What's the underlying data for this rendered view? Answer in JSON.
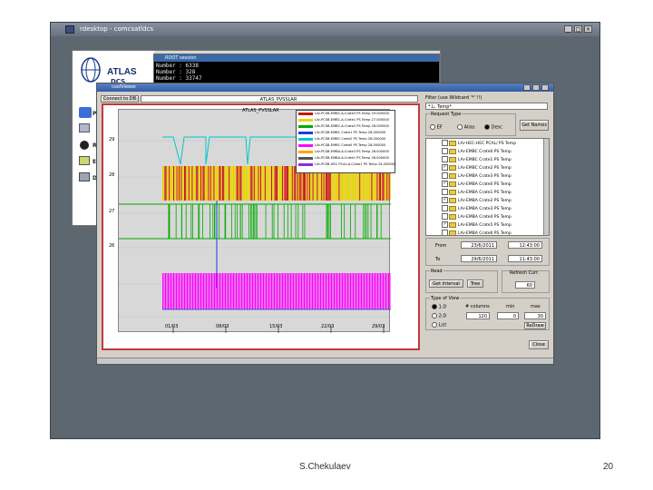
{
  "remote_desktop": {
    "title": "rdesktop - comcsatldcs",
    "controls": [
      "_",
      "□",
      "×"
    ]
  },
  "background_app": {
    "logo_text": "ATLAS",
    "logo_sub": "DCS",
    "side_letters": [
      "P",
      "R",
      "E",
      "D"
    ]
  },
  "root_session": {
    "title": "ROOT session",
    "lines": [
      "Number : 6338",
      "Number : 328",
      "Number : 33747"
    ]
  },
  "viewer": {
    "title": "coolViewer",
    "connect_label": "Connect to DB",
    "db_field": "ATLAS_PVSSLAR",
    "filter_label": "Filter (use Wildcard '*' !!)",
    "filter_value": "*.L: Temp*",
    "request_type_label": "Request Type",
    "request_types": [
      {
        "label": "EF",
        "selected": false
      },
      {
        "label": "Alias",
        "selected": false
      },
      {
        "label": "Desc",
        "selected": true
      }
    ],
    "get_names_button": "Get Names",
    "tree_items": [
      {
        "label": "LAr-HEC-HEC PCAL/ PS Temp",
        "checked": false
      },
      {
        "label": "LAr-EMBC Crate0 PS Temp",
        "checked": false
      },
      {
        "label": "LAr-EMBC Crate1 PS Temp",
        "checked": false
      },
      {
        "label": "LAr-EMBC Crate2 PS Temp",
        "checked": true
      },
      {
        "label": "LAr-EMBA Crate3 PS Temp",
        "checked": false
      },
      {
        "label": "LAr-EMBA Crate0 PS Temp",
        "checked": true
      },
      {
        "label": "LAr-EMBA Crate1 PS Temp",
        "checked": false
      },
      {
        "label": "LAr-EMBA Crate2 PS Temp",
        "checked": true
      },
      {
        "label": "LAr-EMBA Crate3 PS Temp",
        "checked": false
      },
      {
        "label": "LAr-EMBA Crate4 PS Temp",
        "checked": false
      },
      {
        "label": "LAr-EMBA Crate5 PS Temp",
        "checked": true
      },
      {
        "label": "LAr-EMBA Crate6 PS Temp",
        "checked": false
      }
    ],
    "from_label": "From",
    "from_date": "23/6/2011",
    "from_time": "12:43:00",
    "to_label": "To",
    "to_date": "29/6/2011",
    "to_time": "11:43:00",
    "read_label": "Read",
    "get_interval_button": "Get Interval",
    "tree_button": "Tree",
    "refresh_label": "Refresh Curr.",
    "refresh_value": "60",
    "view_type_label": "Type of View",
    "view_types": [
      {
        "label": "1:D",
        "selected": true
      },
      {
        "label": "2:D",
        "selected": false
      },
      {
        "label": "List",
        "selected": false
      }
    ],
    "columns_label": "# columns",
    "columns_value": "120",
    "min_label": "min",
    "min_value": "0",
    "max_label": "max",
    "max_value": "30",
    "redraw_button": "ReDraw",
    "close_button": "Close"
  },
  "plot": {
    "title": "ATLAS_PVSSLAR",
    "y_ticks": [
      "29",
      "28",
      "27",
      "26"
    ],
    "x_ticks": [
      "01/03",
      "08/03",
      "15/03",
      "22/03",
      "29/03"
    ],
    "legend": [
      {
        "label": "LAr-PCSB-EMBC-A-Crate3 PS Temp 29.000000",
        "color": "#cc1111"
      },
      {
        "label": "LAr-PCSB-EMBC-A-Crate1 PS Temp 27.000000",
        "color": "#e8d400"
      },
      {
        "label": "LAr-PCSB-EMBC-A-Crate2 PS Temp 28.000000",
        "color": "#00aa00"
      },
      {
        "label": "LAr-PCSB-EMBC Crate1 PS Temp 28.000000",
        "color": "#1d3fd0"
      },
      {
        "label": "LAr-PCSB-EMBC Crate2 PS Temp 28.000000",
        "color": "#00c8c8"
      },
      {
        "label": "LAr-PCSB-EMBC Crate0 PS Temp 28.000000",
        "color": "#ff00ff"
      },
      {
        "label": "LAr-PCSB-EMBA-A-Crate3 PS Temp 28.000000",
        "color": "#ffa500"
      },
      {
        "label": "LAr-PCSB-EMBA-A-Crate1 PS Temp 28.000000",
        "color": "#555555"
      },
      {
        "label": "LAr-PCSB-HEC PCAL-A-Crate1 PS Temp 24.000000",
        "color": "#8a2be2"
      }
    ]
  },
  "footer": {
    "author": "S.Chekulaev",
    "page": "20"
  }
}
